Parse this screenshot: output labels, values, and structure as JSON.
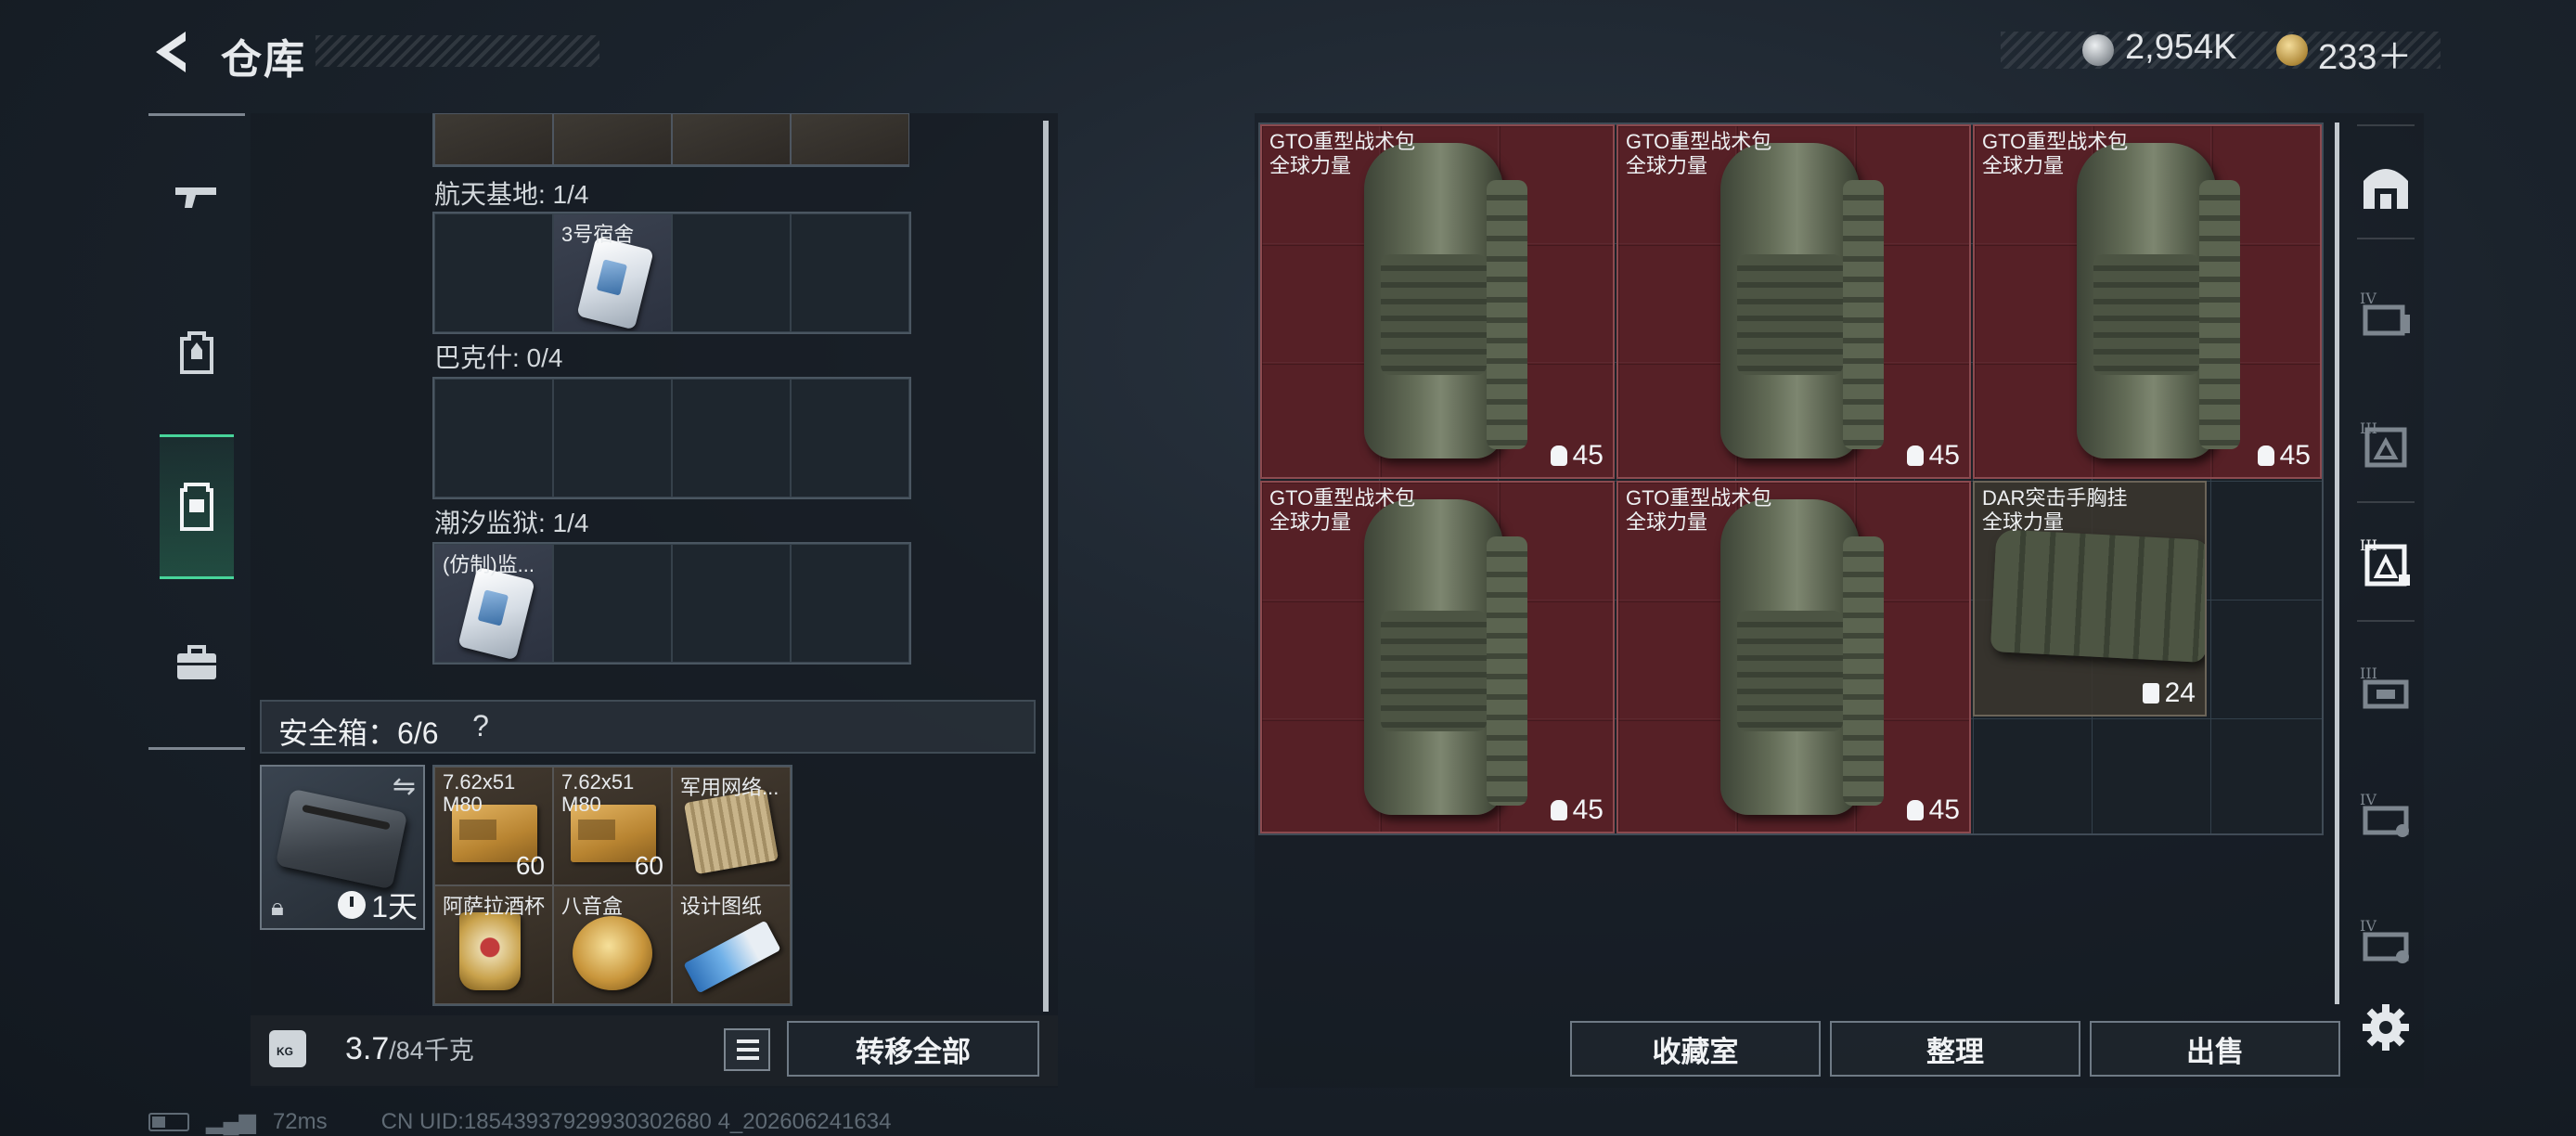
{
  "header": {
    "title": "仓库",
    "currencies": [
      {
        "icon": "silver-coin-icon",
        "value": "2,954K"
      },
      {
        "icon": "gold-coin-icon",
        "value": "233＋"
      }
    ]
  },
  "left_nav": [
    {
      "icon": "gun-icon",
      "active": false
    },
    {
      "icon": "backpack-icon",
      "active": false
    },
    {
      "icon": "vest-icon",
      "active": true
    },
    {
      "icon": "toolbox-icon",
      "active": false
    }
  ],
  "keycards": {
    "sections": [
      {
        "label": "航天基地: 1/4",
        "items": [
          "",
          "3号宿舍",
          "",
          ""
        ]
      },
      {
        "label": "巴克什: 0/4",
        "items": [
          "",
          "",
          "",
          ""
        ]
      },
      {
        "label": "潮汐监狱: 1/4",
        "items": [
          "(仿制)监...",
          "",
          "",
          ""
        ]
      }
    ]
  },
  "safe_box": {
    "title": "安全箱：6/6",
    "help": "?",
    "timer": "1天",
    "items": [
      {
        "name": "7.62x51 M80",
        "count": "60",
        "kind": "ammo"
      },
      {
        "name": "7.62x51 M80",
        "count": "60",
        "kind": "ammo"
      },
      {
        "name": "军用网络...",
        "count": "",
        "kind": "chip"
      },
      {
        "name": "阿萨拉酒杯",
        "count": "",
        "kind": "cup"
      },
      {
        "name": "八音盒",
        "count": "",
        "kind": "musicbox"
      },
      {
        "name": "设计图纸",
        "count": "",
        "kind": "blueprint"
      }
    ]
  },
  "weight": {
    "current": "3.7",
    "max": "/84千克"
  },
  "buttons": {
    "transfer_all": "转移全部",
    "collection": "收藏室",
    "sort": "整理",
    "sell": "出售"
  },
  "storage_items": [
    {
      "name": "GTO重型战术包",
      "faction": "全球力量",
      "durability": "45"
    },
    {
      "name": "GTO重型战术包",
      "faction": "全球力量",
      "durability": "45"
    },
    {
      "name": "GTO重型战术包",
      "faction": "全球力量",
      "durability": "45"
    },
    {
      "name": "GTO重型战术包",
      "faction": "全球力量",
      "durability": "45"
    },
    {
      "name": "GTO重型战术包",
      "faction": "全球力量",
      "durability": "45"
    },
    {
      "name": "DAR突击手胸挂",
      "faction": "全球力量",
      "durability": "24"
    }
  ],
  "side_tabs": [
    {
      "icon": "home-storage-icon"
    },
    {
      "icon": "storage-iv-icon"
    },
    {
      "icon": "storage-iii-icon"
    },
    {
      "icon": "storage-iii-active-icon"
    },
    {
      "icon": "storage-iii-b-icon"
    },
    {
      "icon": "storage-iv-b-icon"
    },
    {
      "icon": "storage-iv-c-icon"
    }
  ],
  "status_bar": {
    "ping": "72ms",
    "uid": "CN UID:18543937929930302680 4_202606241634"
  },
  "colors": {
    "accent": "#47d49a",
    "item_red": "#6e2026",
    "panel": "#161c22"
  }
}
